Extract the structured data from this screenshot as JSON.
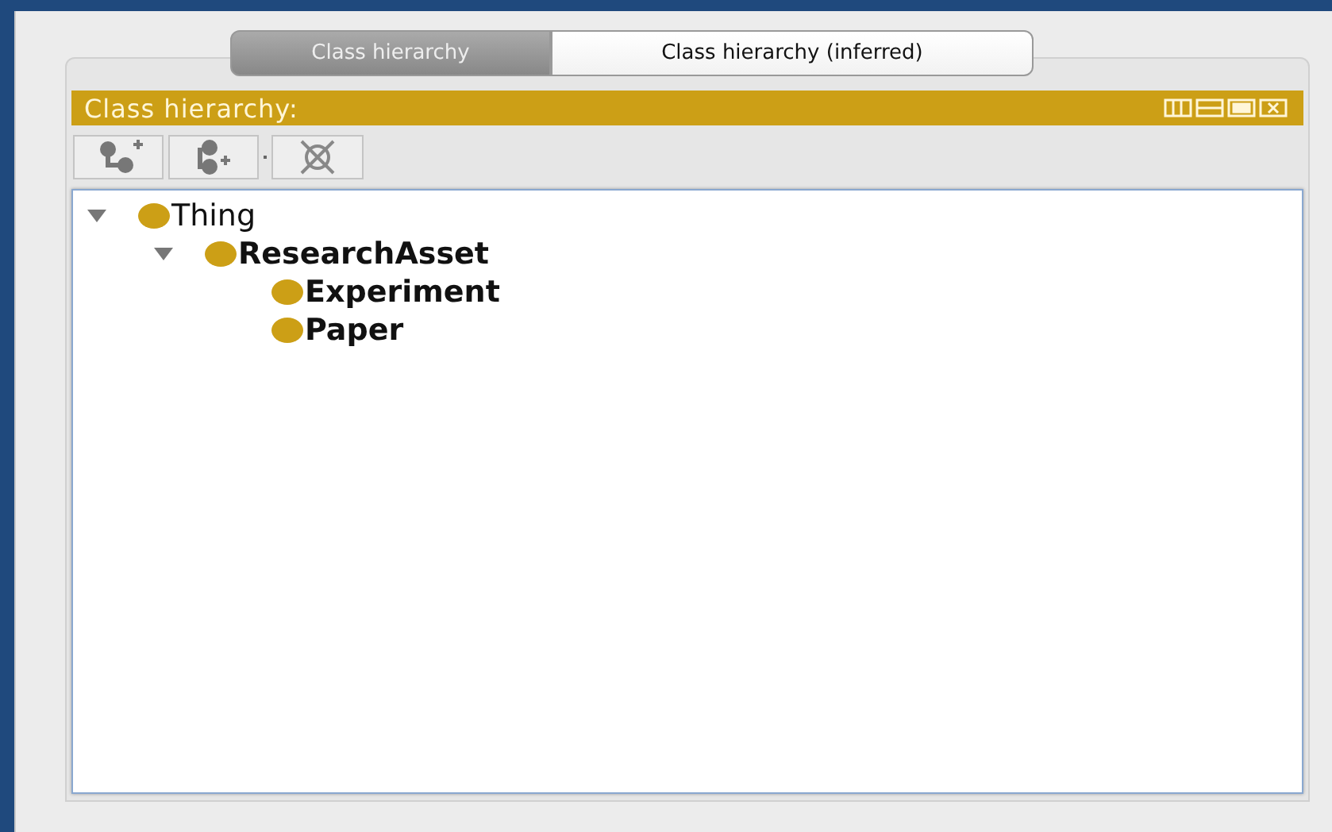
{
  "tabs": [
    {
      "label": "Class hierarchy",
      "selected": true
    },
    {
      "label": "Class hierarchy (inferred)",
      "selected": false
    }
  ],
  "view": {
    "title": "Class hierarchy:"
  },
  "tree": [
    {
      "label": "Thing",
      "bold": false,
      "expanded": true,
      "children": [
        {
          "label": "ResearchAsset",
          "bold": true,
          "expanded": true,
          "children": [
            {
              "label": "Experiment",
              "bold": true
            },
            {
              "label": "Paper",
              "bold": true
            }
          ]
        }
      ]
    }
  ]
}
